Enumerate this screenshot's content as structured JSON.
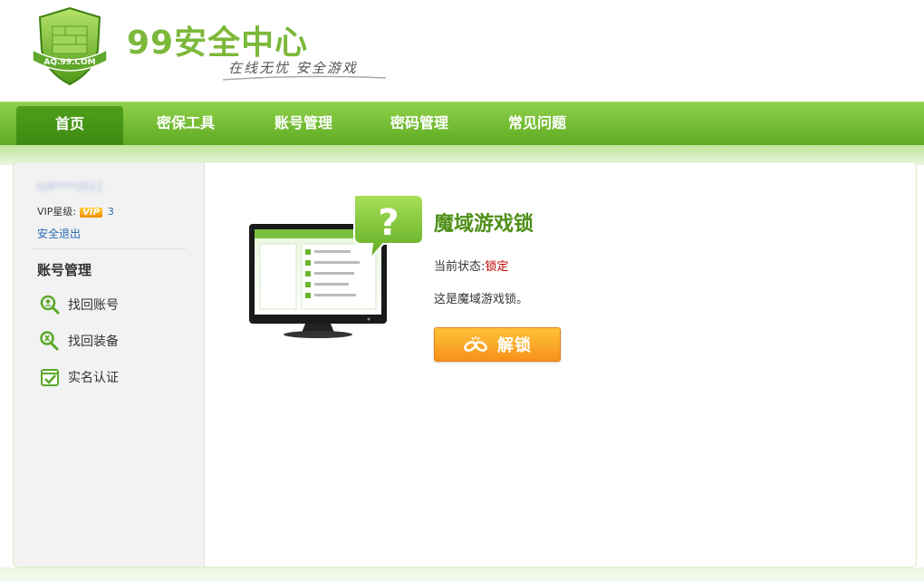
{
  "header": {
    "brand_title": "99安全中心",
    "slogan": "在线无忧  安全游戏",
    "logo_text": "AQ.99.COM"
  },
  "nav": {
    "items": [
      {
        "label": "首页",
        "active": true
      },
      {
        "label": "密保工具",
        "active": false
      },
      {
        "label": "账号管理",
        "active": false
      },
      {
        "label": "密码管理",
        "active": false
      },
      {
        "label": "常见问题",
        "active": false
      }
    ]
  },
  "sidebar": {
    "username": "lu9****2011",
    "vip_label": "VIP星级:",
    "vip_badge": "VIP",
    "vip_level": "3",
    "logout": "安全退出",
    "heading": "账号管理",
    "items": [
      {
        "label": "找回账号",
        "icon": "search-user-icon"
      },
      {
        "label": "找回装备",
        "icon": "search-gear-icon"
      },
      {
        "label": "实名认证",
        "icon": "checkbox-icon"
      }
    ]
  },
  "main": {
    "game_title": "魔域游戏锁",
    "status_label": "当前状态:",
    "status_value": "锁定",
    "description": "这是魔域游戏锁。",
    "unlock_label": "解锁"
  },
  "colors": {
    "brand_green": "#7cb83a",
    "nav_green": "#5eab22",
    "status_red": "#c40000",
    "button_orange": "#f7911a",
    "link_blue": "#2a6ab5"
  }
}
